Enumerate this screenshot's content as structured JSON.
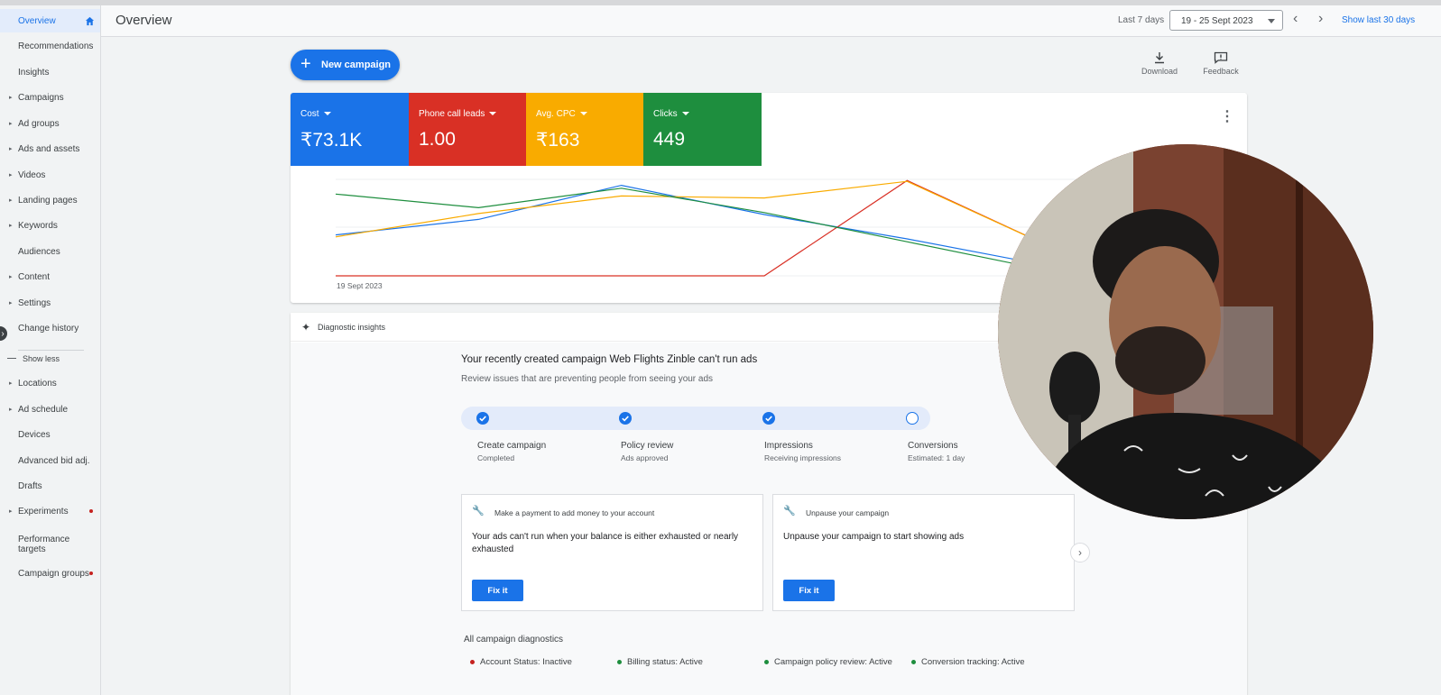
{
  "sidebar": {
    "items": [
      {
        "label": "Overview",
        "caret": false,
        "active": true
      },
      {
        "label": "Recommendations",
        "caret": false
      },
      {
        "label": "Insights",
        "caret": false
      },
      {
        "label": "Campaigns",
        "caret": true
      },
      {
        "label": "Ad groups",
        "caret": true
      },
      {
        "label": "Ads and assets",
        "caret": true
      },
      {
        "label": "Videos",
        "caret": true
      },
      {
        "label": "Landing pages",
        "caret": true
      },
      {
        "label": "Keywords",
        "caret": true
      },
      {
        "label": "Audiences",
        "caret": false
      },
      {
        "label": "Content",
        "caret": true
      },
      {
        "label": "Settings",
        "caret": true
      },
      {
        "label": "Change history",
        "caret": false
      }
    ],
    "show_less": "Show less",
    "items2": [
      {
        "label": "Locations",
        "caret": true
      },
      {
        "label": "Ad schedule",
        "caret": true
      },
      {
        "label": "Devices",
        "caret": false
      },
      {
        "label": "Advanced bid adj.",
        "caret": false
      },
      {
        "label": "Drafts",
        "caret": false
      },
      {
        "label": "Experiments",
        "caret": true,
        "dot": true
      },
      {
        "label": "Performance targets",
        "caret": false
      },
      {
        "label": "Campaign groups",
        "caret": false,
        "dot": true
      }
    ]
  },
  "header": {
    "title": "Overview",
    "range_label": "Last 7 days",
    "date_range": "19 - 25 Sept 2023",
    "show_30": "Show last 30 days"
  },
  "toolbar": {
    "new_campaign": "New campaign",
    "download": "Download",
    "feedback": "Feedback"
  },
  "metrics": [
    {
      "name": "Cost",
      "value": "₹73.1K",
      "color": "#1a73e8"
    },
    {
      "name": "Phone call leads",
      "value": "1.00",
      "color": "#d93025"
    },
    {
      "name": "Avg. CPC",
      "value": "₹163",
      "color": "#f9ab00"
    },
    {
      "name": "Clicks",
      "value": "449",
      "color": "#1e8e3e"
    }
  ],
  "chart_data": {
    "type": "line",
    "x_start_label": "19 Sept 2023",
    "series": [
      {
        "color": "#1a73e8",
        "values": [
          0.42,
          0.58,
          0.93,
          0.63,
          0.38,
          0.1,
          0.05
        ]
      },
      {
        "color": "#d93025",
        "values": [
          0.0,
          0.0,
          0.0,
          0.0,
          0.98,
          0.3,
          0.1
        ]
      },
      {
        "color": "#f9ab00",
        "values": [
          0.4,
          0.64,
          0.82,
          0.8,
          0.97,
          0.3,
          0.1
        ]
      },
      {
        "color": "#1e8e3e",
        "values": [
          0.84,
          0.7,
          0.9,
          0.65,
          0.35,
          0.05,
          0.02
        ]
      }
    ]
  },
  "diagnostics": {
    "header": "Diagnostic insights",
    "issue_title": "Your recently created campaign Web Flights Zinble can't run ads",
    "issue_sub": "Review issues that are preventing people from seeing your ads",
    "steps": [
      {
        "name": "Create campaign",
        "status": "Completed",
        "done": true
      },
      {
        "name": "Policy review",
        "status": "Ads approved",
        "done": true
      },
      {
        "name": "Impressions",
        "status": "Receiving impressions",
        "done": true
      },
      {
        "name": "Conversions",
        "status": "Estimated: 1 day",
        "done": false
      }
    ],
    "recs": [
      {
        "heading": "Make a payment to add money to your account",
        "body": "Your ads can't run when your balance is either exhausted or nearly exhausted",
        "button": "Fix it"
      },
      {
        "heading": "Unpause your campaign",
        "body": "Unpause your campaign to start showing ads",
        "button": "Fix it"
      }
    ],
    "all_title": "All campaign diagnostics",
    "statuses": [
      {
        "text": "Account Status: Inactive",
        "color": "#c5221f"
      },
      {
        "text": "Billing status: Active",
        "color": "#1e8e3e"
      },
      {
        "text": "Campaign policy review: Active",
        "color": "#1e8e3e"
      },
      {
        "text": "Conversion tracking: Active",
        "color": "#1e8e3e"
      }
    ]
  }
}
